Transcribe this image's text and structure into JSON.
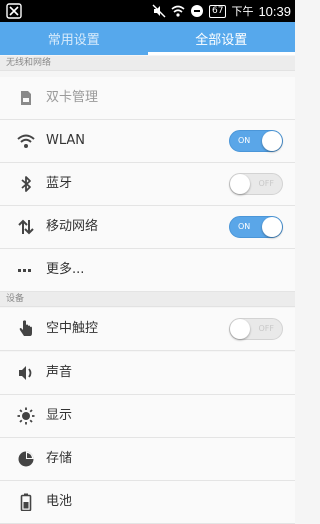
{
  "status_bar": {
    "battery": "67",
    "ampm": "下午",
    "time": "10:39"
  },
  "tabs": [
    {
      "label": "常用设置",
      "active": false
    },
    {
      "label": "全部设置",
      "active": true
    }
  ],
  "sections": {
    "wireless": {
      "header": "无线和网络",
      "items": [
        {
          "label": "双卡管理",
          "icon": "sim-card-icon",
          "disabled": true
        },
        {
          "label": "WLAN",
          "icon": "wifi-icon",
          "toggle": "ON"
        },
        {
          "label": "蓝牙",
          "icon": "bluetooth-icon",
          "toggle": "OFF"
        },
        {
          "label": "移动网络",
          "icon": "mobile-data-icon",
          "toggle": "ON"
        },
        {
          "label": "更多...",
          "icon": "more-icon"
        }
      ]
    },
    "device": {
      "header": "设备",
      "items": [
        {
          "label": "空中触控",
          "icon": "hand-gesture-icon",
          "toggle": "OFF"
        },
        {
          "label": "声音",
          "icon": "speaker-icon"
        },
        {
          "label": "显示",
          "icon": "brightness-icon"
        },
        {
          "label": "存储",
          "icon": "pie-chart-icon"
        },
        {
          "label": "电池",
          "icon": "battery-icon"
        }
      ]
    }
  },
  "colors": {
    "tab_bar": "#56a8ec",
    "toggle_on": "#5aa6e8",
    "toggle_off": "#e9e9e9"
  }
}
